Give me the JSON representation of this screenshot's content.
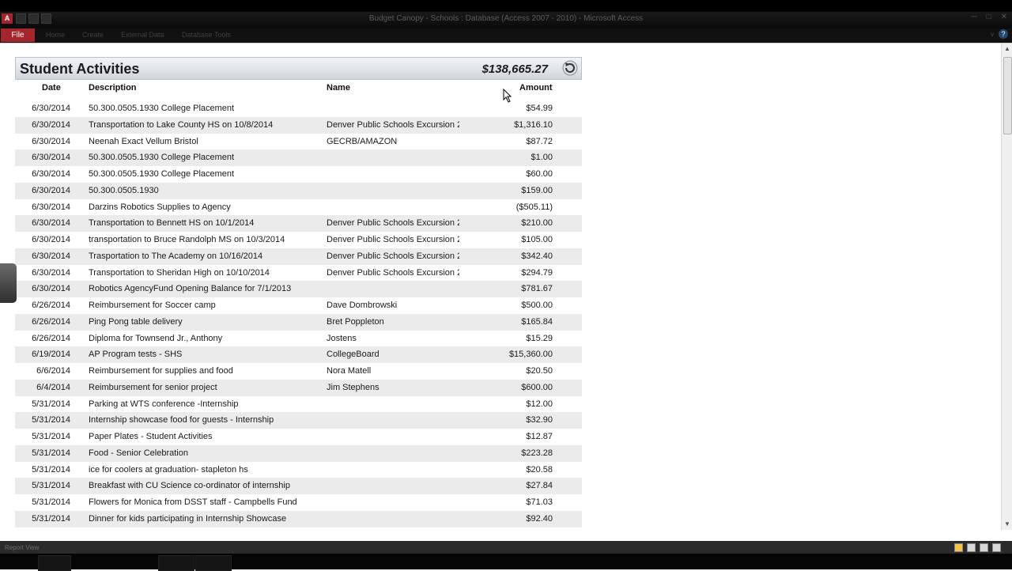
{
  "window": {
    "app_icon_text": "A",
    "title": "Budget Canopy - Schools : Database (Access 2007 - 2010) - Microsoft Access"
  },
  "ribbon": {
    "file": "File",
    "tabs": [
      "Home",
      "Create",
      "External Data",
      "Database Tools"
    ],
    "help": "?"
  },
  "report": {
    "title": "Student Activities",
    "total": "$138,665.27",
    "columns": {
      "date": "Date",
      "description": "Description",
      "name": "Name",
      "amount": "Amount"
    },
    "rows": [
      {
        "date": "6/30/2014",
        "description": "50.300.0505.1930 College Placement",
        "name": "",
        "amount": "$54.99"
      },
      {
        "date": "6/30/2014",
        "description": "Transportation to Lake County HS on 10/8/2014",
        "name": "Denver Public Schools Excursion 2",
        "amount": "$1,316.10"
      },
      {
        "date": "6/30/2014",
        "description": "Neenah Exact Vellum Bristol",
        "name": "GECRB/AMAZON",
        "amount": "$87.72"
      },
      {
        "date": "6/30/2014",
        "description": "50.300.0505.1930 College Placement",
        "name": "",
        "amount": "$1.00"
      },
      {
        "date": "6/30/2014",
        "description": "50.300.0505.1930 College Placement",
        "name": "",
        "amount": "$60.00"
      },
      {
        "date": "6/30/2014",
        "description": "50.300.0505.1930",
        "name": "",
        "amount": "$159.00"
      },
      {
        "date": "6/30/2014",
        "description": "Darzins Robotics Supplies to Agency",
        "name": "",
        "amount": "($505.11)"
      },
      {
        "date": "6/30/2014",
        "description": "Transportation to Bennett HS on 10/1/2014",
        "name": "Denver Public Schools Excursion 2",
        "amount": "$210.00"
      },
      {
        "date": "6/30/2014",
        "description": "transportation to Bruce Randolph MS on 10/3/2014",
        "name": "Denver Public Schools Excursion 2",
        "amount": "$105.00"
      },
      {
        "date": "6/30/2014",
        "description": "Trasportation to The Academy on 10/16/2014",
        "name": "Denver Public Schools Excursion 2",
        "amount": "$342.40"
      },
      {
        "date": "6/30/2014",
        "description": "Transportation to Sheridan High on 10/10/2014",
        "name": "Denver Public Schools Excursion 2",
        "amount": "$294.79"
      },
      {
        "date": "6/30/2014",
        "description": "Robotics AgencyFund Opening Balance for 7/1/2013",
        "name": "",
        "amount": "$781.67"
      },
      {
        "date": "6/26/2014",
        "description": "Reimbursement for Soccer camp",
        "name": "Dave Dombrowski",
        "amount": "$500.00"
      },
      {
        "date": "6/26/2014",
        "description": "Ping Pong table delivery",
        "name": "Bret Poppleton",
        "amount": "$165.84"
      },
      {
        "date": "6/26/2014",
        "description": "Diploma for Townsend Jr., Anthony",
        "name": "Jostens",
        "amount": "$15.29"
      },
      {
        "date": "6/19/2014",
        "description": "AP Program tests - SHS",
        "name": "CollegeBoard",
        "amount": "$15,360.00"
      },
      {
        "date": "6/6/2014",
        "description": "Reimbursement for supplies and food",
        "name": "Nora Matell",
        "amount": "$20.50"
      },
      {
        "date": "6/4/2014",
        "description": "Reimbursement for senior project",
        "name": "Jim Stephens",
        "amount": "$600.00"
      },
      {
        "date": "5/31/2014",
        "description": "Parking at WTS conference -Internship",
        "name": "",
        "amount": "$12.00"
      },
      {
        "date": "5/31/2014",
        "description": "Internship showcase food for guests - Internship",
        "name": "",
        "amount": "$32.90"
      },
      {
        "date": "5/31/2014",
        "description": "Paper Plates - Student Activities",
        "name": "",
        "amount": "$12.87"
      },
      {
        "date": "5/31/2014",
        "description": "Food - Senior Celebration",
        "name": "",
        "amount": "$223.28"
      },
      {
        "date": "5/31/2014",
        "description": "ice for coolers at graduation- stapleton hs",
        "name": "",
        "amount": "$20.58"
      },
      {
        "date": "5/31/2014",
        "description": "Breakfast with CU Science co-ordinator of internship",
        "name": "",
        "amount": "$27.84"
      },
      {
        "date": "5/31/2014",
        "description": "Flowers for Monica from DSST staff - Campbells Fund",
        "name": "",
        "amount": "$71.03"
      },
      {
        "date": "5/31/2014",
        "description": "Dinner for kids participating in Internship Showcase",
        "name": "",
        "amount": "$92.40"
      }
    ]
  },
  "statusbar": {
    "text": "Report View"
  }
}
